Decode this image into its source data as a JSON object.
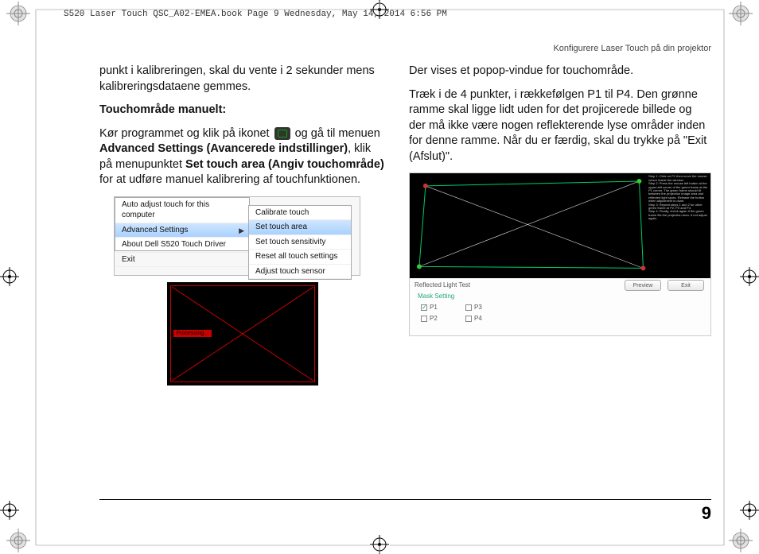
{
  "doc_header": "S520 Laser Touch QSC_A02-EMEA.book  Page 9  Wednesday, May 14, 2014  6:56 PM",
  "section_title": "Konfigurere Laser Touch på din projektor",
  "page_number": "9",
  "left": {
    "p1": "punkt i kalibreringen, skal du vente i 2 sekunder mens kalibreringsdataene gemmes.",
    "subhead": "Touchområde manuelt:",
    "p2a": "Kør programmet og klik på ikonet ",
    "p2b": " og gå til menuen ",
    "p2_bold1": "Advanced Settings (Avancerede indstillinger)",
    "p2c": ", klik på menupunktet ",
    "p2_bold2": "Set touch area (Angiv touchområde)",
    "p2d": " for at udføre manuel kalibrering af touchfunktionen.",
    "menu": {
      "m1": "Auto adjust touch for this computer",
      "m2": "Advanced Settings",
      "m3": "About Dell S520 Touch Driver",
      "m4": "Exit",
      "s1": "Calibrate touch",
      "s2": "Set touch area",
      "s3": "Set touch sensitivity",
      "s4": "Reset all touch settings",
      "s5": "Adjust touch sensor"
    },
    "blackbox_label": "Processing..."
  },
  "right": {
    "p1": "Der vises et popop-vindue for touchområde.",
    "p2": "Træk i de 4 punkter, i rækkefølgen P1 til P4. Den grønne ramme skal ligge lidt uden for det projicerede billede og der må ikke være nogen reflekterende lyse områder inden for denne ramme. Når du er færdig, skal du trykke på \"Exit (Afslut)\".",
    "calib": {
      "panel_title": "Reflected Light Test",
      "panel_sub": "Mask Setting",
      "chk_p1": "P1",
      "chk_p2": "P2",
      "chk_p3": "P3",
      "chk_p4": "P4",
      "btn_preview": "Preview",
      "btn_exit": "Exit"
    }
  }
}
